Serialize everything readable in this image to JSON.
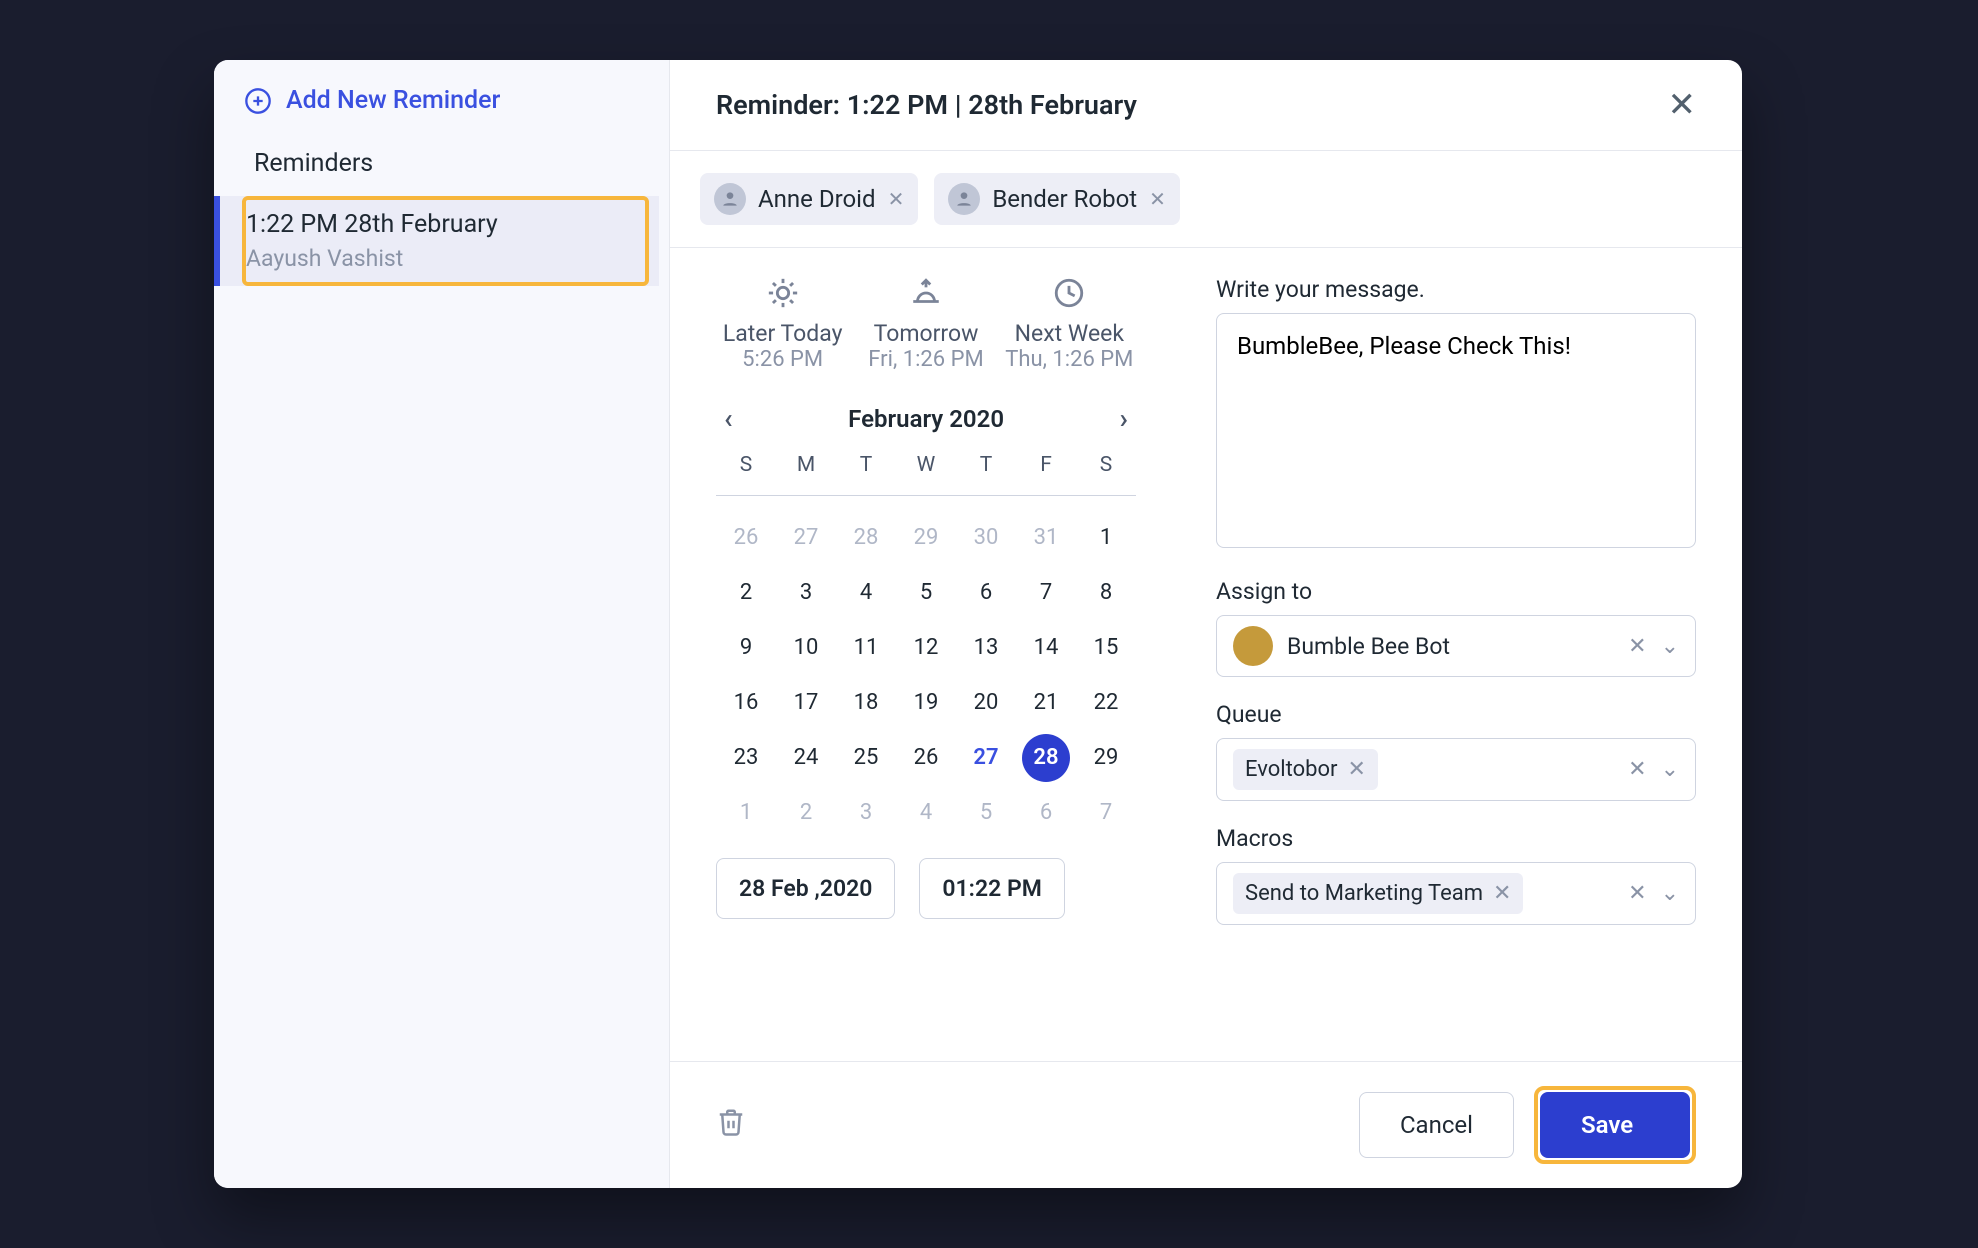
{
  "sidebar": {
    "add_label": "Add New Reminder",
    "section_label": "Reminders",
    "items": [
      {
        "title": "1:22 PM 28th February",
        "subtitle": "Aayush Vashist"
      }
    ]
  },
  "header": {
    "title": "Reminder: 1:22 PM | 28th February"
  },
  "participants": [
    {
      "name": "Anne Droid"
    },
    {
      "name": "Bender Robot"
    }
  ],
  "quick": {
    "later": {
      "label": "Later Today",
      "sub": "5:26 PM"
    },
    "tomorrow": {
      "label": "Tomorrow",
      "sub": "Fri, 1:26 PM"
    },
    "nextweek": {
      "label": "Next Week",
      "sub": "Thu, 1:26 PM"
    }
  },
  "calendar": {
    "month_label": "February 2020",
    "dow": [
      "S",
      "M",
      "T",
      "W",
      "T",
      "F",
      "S"
    ],
    "weeks": [
      [
        {
          "d": "26",
          "dim": true
        },
        {
          "d": "27",
          "dim": true
        },
        {
          "d": "28",
          "dim": true
        },
        {
          "d": "29",
          "dim": true
        },
        {
          "d": "30",
          "dim": true
        },
        {
          "d": "31",
          "dim": true
        },
        {
          "d": "1"
        }
      ],
      [
        {
          "d": "2"
        },
        {
          "d": "3"
        },
        {
          "d": "4"
        },
        {
          "d": "5"
        },
        {
          "d": "6"
        },
        {
          "d": "7"
        },
        {
          "d": "8"
        }
      ],
      [
        {
          "d": "9"
        },
        {
          "d": "10"
        },
        {
          "d": "11"
        },
        {
          "d": "12"
        },
        {
          "d": "13"
        },
        {
          "d": "14"
        },
        {
          "d": "15"
        }
      ],
      [
        {
          "d": "16"
        },
        {
          "d": "17"
        },
        {
          "d": "18"
        },
        {
          "d": "19"
        },
        {
          "d": "20"
        },
        {
          "d": "21"
        },
        {
          "d": "22"
        }
      ],
      [
        {
          "d": "23"
        },
        {
          "d": "24"
        },
        {
          "d": "25"
        },
        {
          "d": "26"
        },
        {
          "d": "27",
          "today": true
        },
        {
          "d": "28",
          "sel": true
        },
        {
          "d": "29"
        }
      ],
      [
        {
          "d": "1",
          "dim": true
        },
        {
          "d": "2",
          "dim": true
        },
        {
          "d": "3",
          "dim": true
        },
        {
          "d": "4",
          "dim": true
        },
        {
          "d": "5",
          "dim": true
        },
        {
          "d": "6",
          "dim": true
        },
        {
          "d": "7",
          "dim": true
        }
      ]
    ],
    "date_value": "28 Feb ,2020",
    "time_value": "01:22 PM"
  },
  "message": {
    "label": "Write your message.",
    "value": "BumbleBee, Please Check This!"
  },
  "assign": {
    "label": "Assign to",
    "value": "Bumble Bee Bot"
  },
  "queue": {
    "label": "Queue",
    "value": "Evoltobor"
  },
  "macros": {
    "label": "Macros",
    "value": "Send to Marketing Team"
  },
  "footer": {
    "cancel": "Cancel",
    "save": "Save"
  }
}
